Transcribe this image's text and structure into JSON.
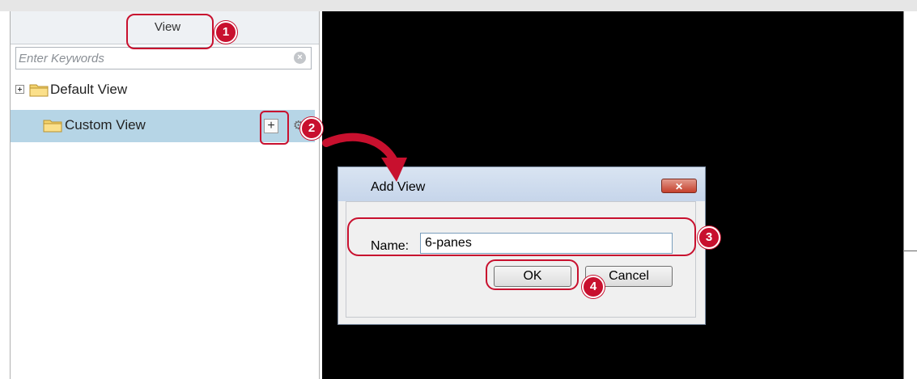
{
  "left_panel": {
    "tab_label": "View",
    "search": {
      "placeholder": "Enter Keywords"
    },
    "tree": [
      {
        "label": "Default View"
      },
      {
        "label": "Custom View"
      }
    ],
    "add_button_label": "+"
  },
  "dialog": {
    "title": "Add View",
    "close_label": "✕",
    "name_label": "Name:",
    "name_value": "6-panes",
    "ok_label": "OK",
    "cancel_label": "Cancel"
  },
  "callouts": [
    "1",
    "2",
    "3",
    "4"
  ],
  "colors": {
    "callout_red": "#c8102e",
    "selected_row": "#b6d5e6",
    "video_background": "#000000"
  }
}
